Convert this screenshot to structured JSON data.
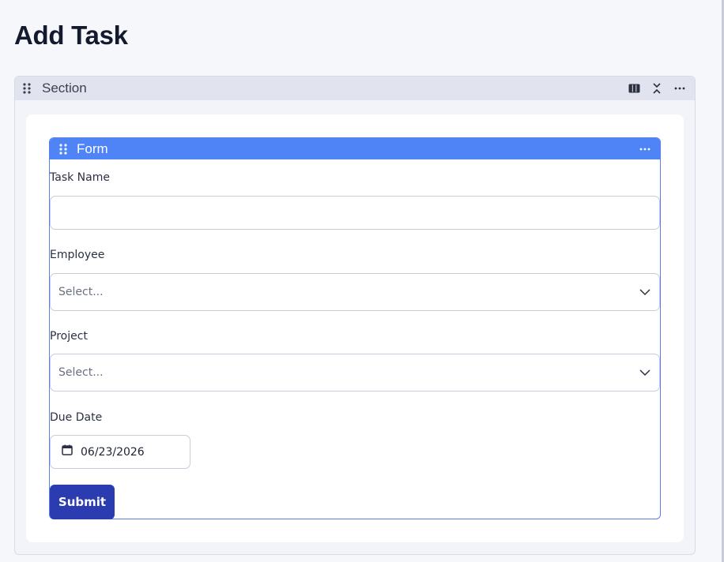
{
  "page": {
    "title": "Add Task"
  },
  "section": {
    "title": "Section",
    "icons": [
      "drag-handle-icon",
      "columns-icon",
      "collapse-icon",
      "more-icon"
    ]
  },
  "form": {
    "title": "Form",
    "fields": {
      "task_name": {
        "label": "Task Name",
        "value": "",
        "placeholder": ""
      },
      "employee": {
        "label": "Employee",
        "value": "Select..."
      },
      "project": {
        "label": "Project",
        "value": "Select..."
      },
      "due_date": {
        "label": "Due Date",
        "value": "06/23/2026"
      }
    },
    "submit_label": "Submit"
  },
  "colors": {
    "form_header": "#4f84f6",
    "submit_button": "#2b3bb0",
    "section_header": "#e1e4ee"
  }
}
